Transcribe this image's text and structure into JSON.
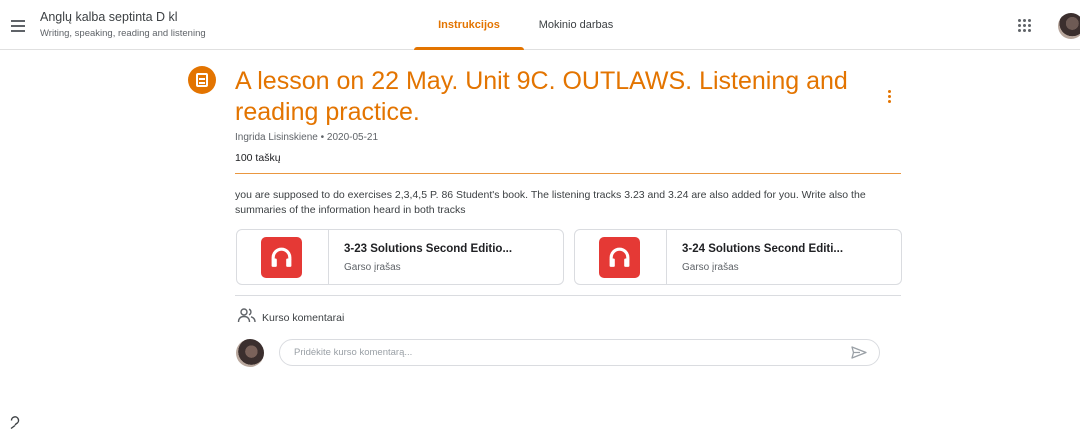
{
  "header": {
    "class_title": "Anglų kalba septinta D kl",
    "class_subtitle": "Writing, speaking, reading and listening",
    "tabs": [
      {
        "label": "Instrukcijos",
        "active": true
      },
      {
        "label": "Mokinio darbas",
        "active": false
      }
    ],
    "icons": [
      "menu-icon",
      "apps-grid-icon",
      "avatar"
    ]
  },
  "assignment": {
    "icon": "assignment-icon",
    "title": "A lesson on 22 May. Unit 9C. OUTLAWS. Listening and reading practice.",
    "author": "Ingrida Lisinskiene",
    "date": "2020-05-21",
    "meta": "Ingrida Lisinskiene • 2020-05-21",
    "points": "100 taškų",
    "description": "you are supposed to do exercises 2,3,4,5 P. 86 Student's book. The listening tracks 3.23 and 3.24 are also added for you. Write also the summaries of the information heard in both tracks"
  },
  "attachments": [
    {
      "title": "3-23 Solutions Second Editio...",
      "type": "Garso įrašas",
      "icon": "headphones-icon"
    },
    {
      "title": "3-24 Solutions Second Editi...",
      "type": "Garso įrašas",
      "icon": "headphones-icon"
    }
  ],
  "comments": {
    "label": "Kurso komentarai",
    "placeholder": "Pridėkite kurso komentarą...",
    "icon": "people-icon",
    "send_icon": "send-icon"
  },
  "colors": {
    "accent": "#e37400",
    "attachment_badge": "#e53935",
    "divider": "#dadce0"
  }
}
